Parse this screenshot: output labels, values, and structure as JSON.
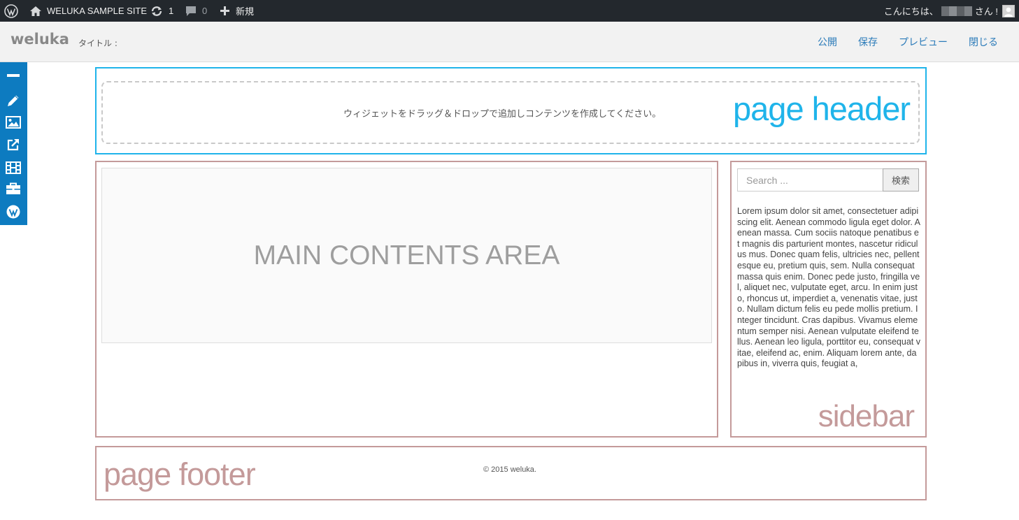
{
  "admin_bar": {
    "site_name": "WELUKA SAMPLE SITE",
    "updates_count": "1",
    "comments_count": "0",
    "new_label": "新規",
    "greeting_prefix": "こんにちは、",
    "greeting_suffix": "さん !"
  },
  "editor": {
    "logo": "weluka",
    "title_label": "タイトル :",
    "actions": {
      "publish": "公開",
      "save": "保存",
      "preview": "プレビュー",
      "close": "閉じる"
    }
  },
  "toolbar": {
    "icons": [
      "minus-icon",
      "pencil-icon",
      "image-icon",
      "external-link-icon",
      "film-icon",
      "briefcase-icon",
      "wordpress-icon"
    ]
  },
  "page_header": {
    "label": "page header",
    "dropzone_message": "ウィジェットをドラッグ＆ドロップで追加しコンテンツを作成してください。"
  },
  "main": {
    "label": "MAIN CONTENTS AREA"
  },
  "sidebar": {
    "label": "sidebar",
    "search_placeholder": "Search ...",
    "search_button": "検索",
    "text": "Lorem ipsum dolor sit amet, consectetuer adipiscing elit. Aenean commodo ligula eget dolor. Aenean massa. Cum sociis natoque penatibus et magnis dis parturient montes, nascetur ridiculus mus. Donec quam felis, ultricies nec, pellentesque eu, pretium quis, sem. Nulla consequat massa quis enim. Donec pede justo, fringilla vel, aliquet nec, vulputate eget, arcu. In enim justo, rhoncus ut, imperdiet a, venenatis vitae, justo. Nullam dictum felis eu pede mollis pretium. Integer tincidunt. Cras dapibus. Vivamus elementum semper nisi. Aenean vulputate eleifend tellus. Aenean leo ligula, porttitor eu, consequat vitae, eleifend ac, enim. Aliquam lorem ante, dapibus in, viverra quis, feugiat a,"
  },
  "footer": {
    "label": "page footer",
    "copyright": "© 2015 weluka."
  },
  "colors": {
    "header_accent": "#1fb4ea",
    "region_accent": "#c49a9a",
    "toolbar_bg": "#0d7bc0",
    "action_link": "#2b7bb9"
  }
}
